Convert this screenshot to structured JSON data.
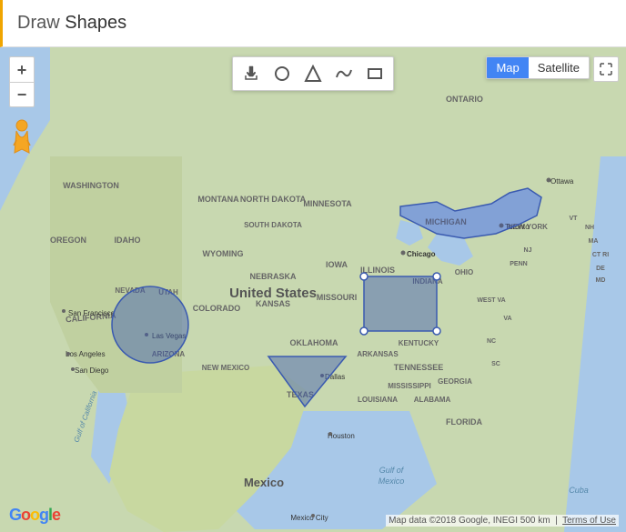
{
  "header": {
    "title": "Draw Shapes",
    "title_plain": "Draw ",
    "title_highlight": "Shapes"
  },
  "toolbar": {
    "buttons": [
      {
        "id": "hand",
        "label": "✋",
        "tooltip": "Pan",
        "active": false
      },
      {
        "id": "circle",
        "label": "●",
        "tooltip": "Draw Circle",
        "active": false
      },
      {
        "id": "marker",
        "label": "▲",
        "tooltip": "Draw Marker",
        "active": false
      },
      {
        "id": "polyline",
        "label": "〰",
        "tooltip": "Draw Polyline",
        "active": false
      },
      {
        "id": "rectangle",
        "label": "▭",
        "tooltip": "Draw Rectangle",
        "active": false
      }
    ]
  },
  "zoom": {
    "plus_label": "+",
    "minus_label": "−"
  },
  "map_type": {
    "map_label": "Map",
    "satellite_label": "Satellite",
    "active": "map"
  },
  "attribution": "Map data ©2018 Google, INEGI   500 km",
  "terms_label": "Terms of Use",
  "google_label": "Google",
  "map_labels": {
    "california": "CALIFORNIA",
    "las_vegas": "Las Vegas",
    "washington": "WASHINGTON",
    "oregon": "OREGON",
    "idaho": "IDAHO",
    "nevada": "NEVADA",
    "utah": "UTAH",
    "arizona": "ARIZONA",
    "montana": "MONTANA",
    "wyoming": "WYOMING",
    "colorado": "COLORADO",
    "new_mexico": "NEW MEXICO",
    "texas": "TEXAS",
    "oklahoma": "OKLAHOMA",
    "north_dakota": "NORTH DAKOTA",
    "south_dakota": "SOUTH DAKOTA",
    "nebraska": "NEBRASKA",
    "kansas": "KANSAS",
    "minnesota": "MINNESOTA",
    "iowa": "IOWA",
    "missouri": "MISSOURI",
    "illinois": "ILLINOIS",
    "michigan": "MICHIGAN",
    "indiana": "INDIANA",
    "ohio": "OHIO",
    "kentucky": "KENTUCKY",
    "tennessee": "TENNESSEE",
    "arkansas": "ARKANSAS",
    "louisiana": "LOUISIANA",
    "mississippi": "MISSISSIPPI",
    "alabama": "ALABAMA",
    "georgia": "GEORGIA",
    "florida": "FLORIDA",
    "south_carolina": "SOUTH CAROLINA",
    "north_carolina": "NORTH CAROLINA",
    "west_virginia": "WEST VIRGINIA",
    "virginia": "VIRGINIA",
    "pennsylvania": "PENN",
    "new_york": "NEW YORK",
    "united_states": "United States",
    "mexico": "Mexico",
    "ontario": "ONTARIO",
    "ottawa": "Ottawa",
    "toronto": "Toronto",
    "chicago": "Chicago",
    "houston": "Houston",
    "dallas": "Dallas",
    "san_francisco": "San Francisco",
    "los_angeles": "Los Angeles",
    "san_diego": "San Diego",
    "gulf_california": "Gulf of\nCalifornia",
    "gulf_mexico": "Gulf of\nMexico",
    "mexico_city": "Mexico City",
    "cuba": "Cuba"
  },
  "accent_color": "#f0a500",
  "shape_color": "#4a6ec0",
  "shape_fill": "rgba(74,110,192,0.45)"
}
